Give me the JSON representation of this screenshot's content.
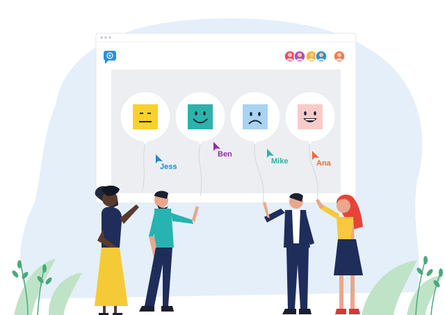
{
  "colors": {
    "backdrop": "#e4eff9",
    "window_frame": "#ffffff",
    "window_bar_dots": "#c9ccd3",
    "content_panel": "#eceef2",
    "chat_icon": "#2d8fd6",
    "balloon": "#ffffff",
    "balloon_string": "#d7dbe2"
  },
  "window": {
    "app_icon": "chat-bubble-icon",
    "participants": [
      {
        "name": "participant-1-avatar",
        "bg": "#e94d6f"
      },
      {
        "name": "participant-2-avatar",
        "bg": "#b54fb8"
      },
      {
        "name": "participant-3-avatar",
        "bg": "#f2b630"
      },
      {
        "name": "participant-4-avatar",
        "bg": "#2d8fd6"
      }
    ],
    "self_avatar": {
      "name": "self-avatar",
      "bg": "#f47a4f"
    }
  },
  "balloons": [
    {
      "mood": "neutral",
      "face_color": "#f8d12e"
    },
    {
      "mood": "happy",
      "face_color": "#2bb3ab"
    },
    {
      "mood": "sad",
      "face_color": "#a9d3f1"
    },
    {
      "mood": "grin",
      "face_color": "#f8cbc8"
    }
  ],
  "cursors": [
    {
      "label": "Jess",
      "color": "#1b88d8"
    },
    {
      "label": "Ben",
      "color": "#8e2fa3"
    },
    {
      "label": "Mike",
      "color": "#27b3aa"
    },
    {
      "label": "Ana",
      "color": "#f2673a"
    }
  ]
}
